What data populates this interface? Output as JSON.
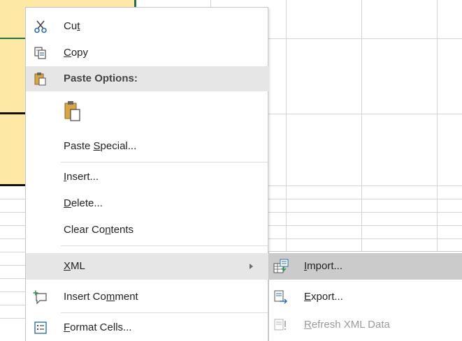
{
  "colors": {
    "selection_fill": "#fde9a5",
    "menu_highlight": "#e6e6e6",
    "submenu_highlight": "#cbcbcb",
    "disabled_text": "#9a9a9a"
  },
  "context_menu": {
    "cut": {
      "pre": "Cu",
      "u": "t",
      "post": "",
      "icon": "scissors-icon"
    },
    "copy": {
      "pre": "",
      "u": "C",
      "post": "opy",
      "icon": "copy-icon"
    },
    "paste_header": {
      "label": "Paste Options:",
      "icon": "clipboard-icon"
    },
    "paste_option": {
      "icon": "paste-clipboard-icon"
    },
    "paste_special": {
      "pre": "Paste ",
      "u": "S",
      "post": "pecial..."
    },
    "insert": {
      "pre": "",
      "u": "I",
      "post": "nsert..."
    },
    "delete": {
      "pre": "",
      "u": "D",
      "post": "elete..."
    },
    "clear_contents": {
      "pre": "Clear Co",
      "u": "n",
      "post": "tents"
    },
    "xml": {
      "pre": "",
      "u": "X",
      "post": "ML"
    },
    "insert_comment": {
      "pre": "Insert Co",
      "u": "m",
      "post": "ment",
      "icon": "comment-icon"
    },
    "format_cells": {
      "pre": "",
      "u": "F",
      "post": "ormat Cells...",
      "icon": "format-cells-icon"
    }
  },
  "xml_submenu": {
    "import": {
      "pre": "",
      "u": "I",
      "post": "mport...",
      "icon": "xml-import-icon"
    },
    "export": {
      "pre": "",
      "u": "E",
      "post": "xport...",
      "icon": "xml-export-icon"
    },
    "refresh": {
      "pre": "",
      "u": "R",
      "post": "efresh XML Data",
      "icon": "xml-refresh-icon",
      "disabled": true
    }
  }
}
